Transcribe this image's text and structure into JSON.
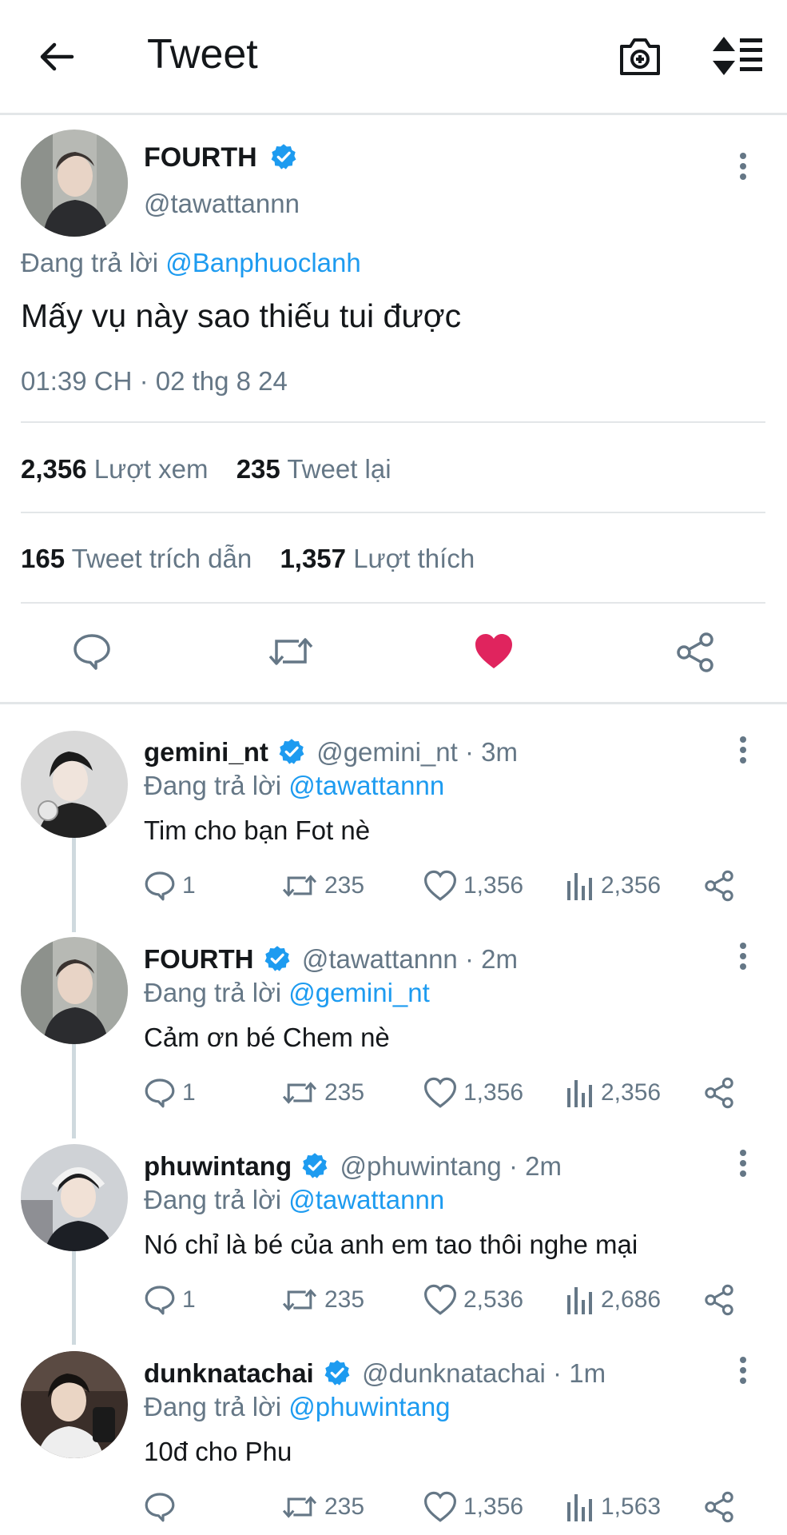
{
  "header": {
    "title": "Tweet"
  },
  "main_tweet": {
    "name": "FOURTH",
    "handle": "@tawattannn",
    "reply_prefix": "Đang trả lời",
    "reply_to": "@Banphuoclanh",
    "text": "Mấy vụ này sao thiếu tui được",
    "timestamp": "01:39 CH · 02 thg 8 24",
    "stats": {
      "views_num": "2,356",
      "views_label": "Lượt xem",
      "retweets_num": "235",
      "retweets_label": "Tweet lại",
      "quotes_num": "165",
      "quotes_label": "Tweet trích dẫn",
      "likes_num": "1,357",
      "likes_label": "Lượt thích"
    },
    "liked": true,
    "like_color": "#e0245e"
  },
  "replies": [
    {
      "name": "gemini_nt",
      "handle": "@gemini_nt · 3m",
      "reply_prefix": "Đang trả lời",
      "reply_to": "@tawattannn",
      "text": "Tim cho bạn Fot nè",
      "replies": "1",
      "retweets": "235",
      "likes": "1,356",
      "views": "2,356"
    },
    {
      "name": "FOURTH",
      "handle": "@tawattannn · 2m",
      "reply_prefix": "Đang trả lời",
      "reply_to": "@gemini_nt",
      "text": "Cảm ơn bé Chem nè",
      "replies": "1",
      "retweets": "235",
      "likes": "1,356",
      "views": "2,356"
    },
    {
      "name": "phuwintang",
      "handle": "@phuwintang · 2m",
      "reply_prefix": "Đang trả lời",
      "reply_to": "@tawattannn",
      "text": "Nó chỉ là bé của anh em tao thôi nghe mại",
      "replies": "1",
      "retweets": "235",
      "likes": "2,536",
      "views": "2,686"
    },
    {
      "name": "dunknatachai",
      "handle": "@dunknatachai · 1m",
      "reply_prefix": "Đang trả lời",
      "reply_to": "@phuwintang",
      "text": "10đ cho Phu",
      "replies": "",
      "retweets": "235",
      "likes": "1,356",
      "views": "1,563"
    }
  ],
  "colors": {
    "accent": "#1d9bf0",
    "muted": "#657786",
    "text": "#14171a",
    "like": "#e0245e"
  },
  "icons": [
    "back-arrow-icon",
    "camera-plus-icon",
    "sort-icon",
    "verified-badge-icon",
    "more-vert-icon",
    "reply-icon",
    "retweet-icon",
    "heart-icon",
    "share-icon",
    "views-icon"
  ]
}
